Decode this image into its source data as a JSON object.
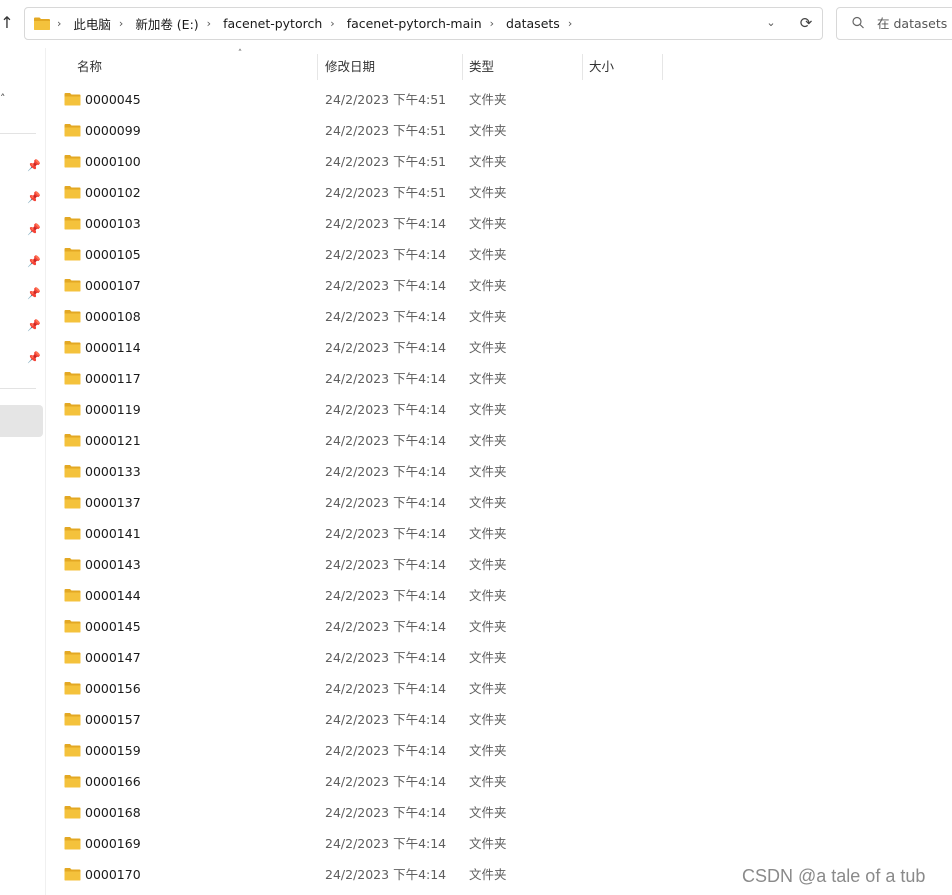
{
  "address_bar": {
    "breadcrumbs": [
      "此电脑",
      "新加卷 (E:)",
      "facenet-pytorch",
      "facenet-pytorch-main",
      "datasets"
    ]
  },
  "search": {
    "placeholder": "在 datasets 中"
  },
  "columns": {
    "name": "名称",
    "modified": "修改日期",
    "type": "类型",
    "size": "大小"
  },
  "icons": {
    "up": "arrow-up-icon",
    "folder": "folder-icon",
    "pin": "pin-icon",
    "search": "search-icon",
    "refresh": "refresh-icon",
    "dropdown": "chevron-down-icon"
  },
  "colors": {
    "folder": "#f4c23c",
    "folder_dark": "#e3a823",
    "selection": "#e5e5e5"
  },
  "files": [
    {
      "name": "0000045",
      "date": "24/2/2023 下午4:51",
      "type": "文件夹"
    },
    {
      "name": "0000099",
      "date": "24/2/2023 下午4:51",
      "type": "文件夹"
    },
    {
      "name": "0000100",
      "date": "24/2/2023 下午4:51",
      "type": "文件夹"
    },
    {
      "name": "0000102",
      "date": "24/2/2023 下午4:51",
      "type": "文件夹"
    },
    {
      "name": "0000103",
      "date": "24/2/2023 下午4:14",
      "type": "文件夹"
    },
    {
      "name": "0000105",
      "date": "24/2/2023 下午4:14",
      "type": "文件夹"
    },
    {
      "name": "0000107",
      "date": "24/2/2023 下午4:14",
      "type": "文件夹"
    },
    {
      "name": "0000108",
      "date": "24/2/2023 下午4:14",
      "type": "文件夹"
    },
    {
      "name": "0000114",
      "date": "24/2/2023 下午4:14",
      "type": "文件夹"
    },
    {
      "name": "0000117",
      "date": "24/2/2023 下午4:14",
      "type": "文件夹"
    },
    {
      "name": "0000119",
      "date": "24/2/2023 下午4:14",
      "type": "文件夹"
    },
    {
      "name": "0000121",
      "date": "24/2/2023 下午4:14",
      "type": "文件夹"
    },
    {
      "name": "0000133",
      "date": "24/2/2023 下午4:14",
      "type": "文件夹"
    },
    {
      "name": "0000137",
      "date": "24/2/2023 下午4:14",
      "type": "文件夹"
    },
    {
      "name": "0000141",
      "date": "24/2/2023 下午4:14",
      "type": "文件夹"
    },
    {
      "name": "0000143",
      "date": "24/2/2023 下午4:14",
      "type": "文件夹"
    },
    {
      "name": "0000144",
      "date": "24/2/2023 下午4:14",
      "type": "文件夹"
    },
    {
      "name": "0000145",
      "date": "24/2/2023 下午4:14",
      "type": "文件夹"
    },
    {
      "name": "0000147",
      "date": "24/2/2023 下午4:14",
      "type": "文件夹"
    },
    {
      "name": "0000156",
      "date": "24/2/2023 下午4:14",
      "type": "文件夹"
    },
    {
      "name": "0000157",
      "date": "24/2/2023 下午4:14",
      "type": "文件夹"
    },
    {
      "name": "0000159",
      "date": "24/2/2023 下午4:14",
      "type": "文件夹"
    },
    {
      "name": "0000166",
      "date": "24/2/2023 下午4:14",
      "type": "文件夹"
    },
    {
      "name": "0000168",
      "date": "24/2/2023 下午4:14",
      "type": "文件夹"
    },
    {
      "name": "0000169",
      "date": "24/2/2023 下午4:14",
      "type": "文件夹"
    },
    {
      "name": "0000170",
      "date": "24/2/2023 下午4:14",
      "type": "文件夹"
    }
  ],
  "watermark": "CSDN @a tale of a tub"
}
